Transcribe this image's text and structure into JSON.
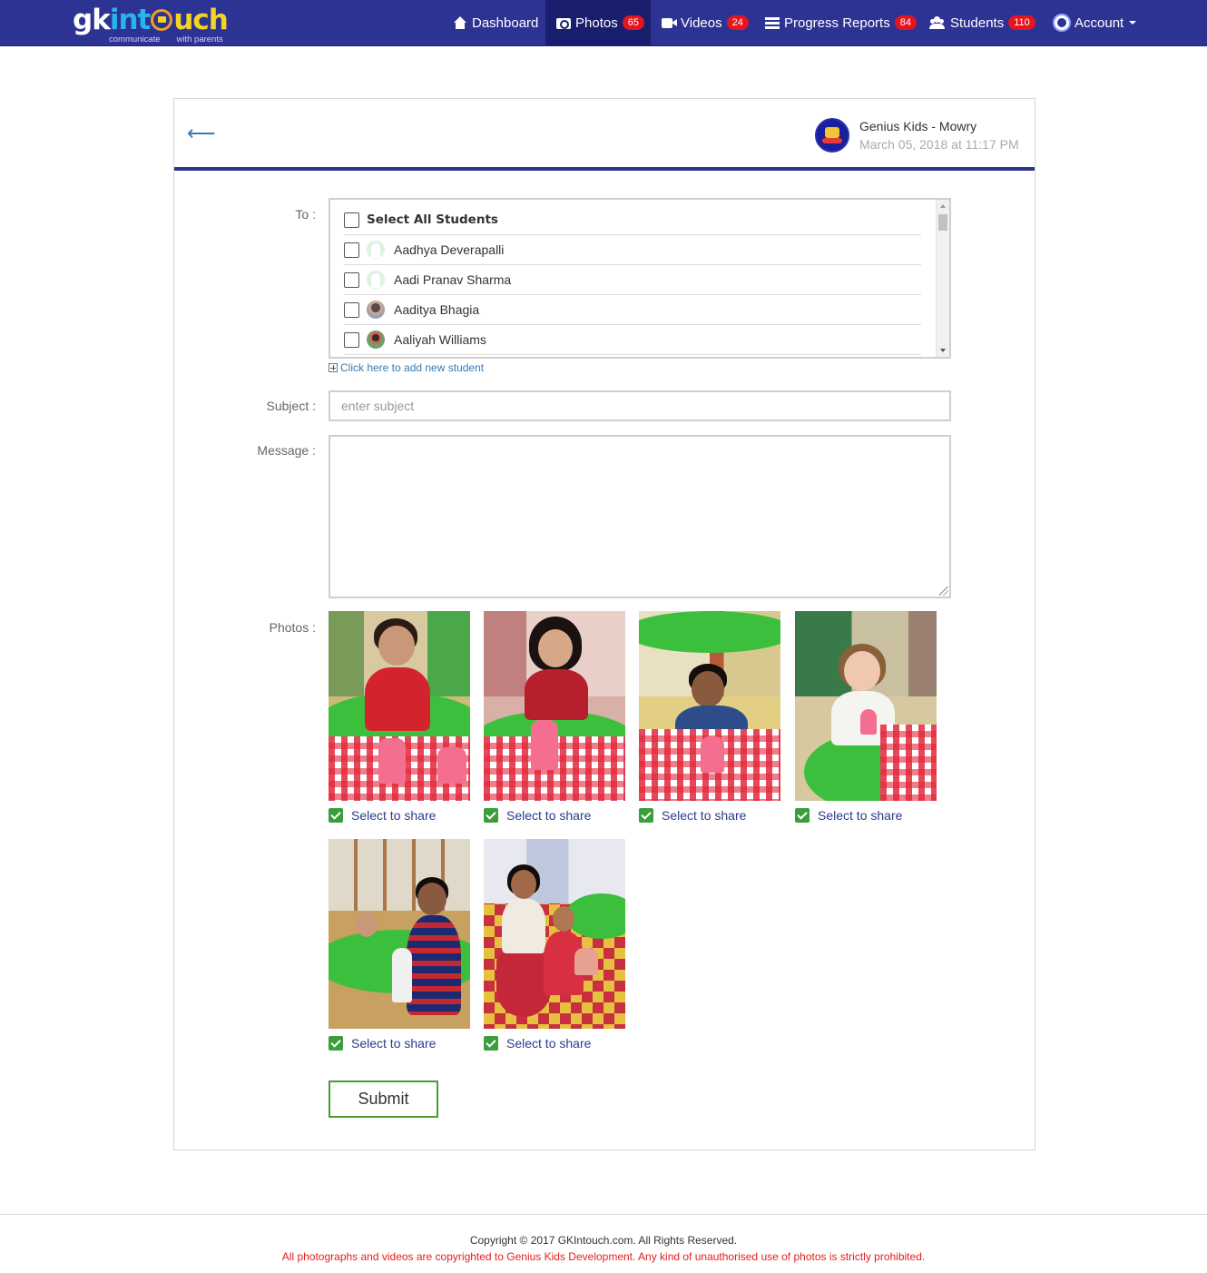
{
  "logo": {
    "part1": "gk",
    "part2": "int",
    "part3": "uch",
    "tagline_left": "communicate",
    "tagline_right": "with parents"
  },
  "nav": {
    "dashboard": {
      "label": "Dashboard"
    },
    "photos": {
      "label": "Photos",
      "count": "65"
    },
    "videos": {
      "label": "Videos",
      "count": "24"
    },
    "progress": {
      "label": "Progress Reports",
      "count": "84"
    },
    "students": {
      "label": "Students",
      "count": "110"
    },
    "account": {
      "label": "Account"
    }
  },
  "header": {
    "back_arrow": "⟵",
    "poster_name": "Genius Kids - Mowry",
    "poster_date": "March 05, 2018 at 11:17 PM"
  },
  "form": {
    "to_label": "To :",
    "select_all": "Select All Students",
    "students": [
      "Aadhya Deverapalli",
      "Aadi Pranav Sharma",
      "Aaditya Bhagia",
      "Aaliyah Williams"
    ],
    "add_student": "Click here to add new student",
    "subject_label": "Subject :",
    "subject_placeholder": "enter subject",
    "subject_value": "",
    "message_label": "Message :",
    "message_value": "",
    "photos_label": "Photos :",
    "share_label": "Select to share",
    "submit": "Submit"
  },
  "colors": {
    "nav_bg": "#2d3393",
    "accent_blue": "#337ab7",
    "badge_red": "#e6141f",
    "check_green": "#3c9d3c",
    "submit_border": "#4a9d2f"
  },
  "footer": {
    "copyright": "Copyright © 2017 GKIntouch.com. All Rights Reserved.",
    "warning": "All photographs and videos are copyrighted to Genius Kids Development. Any kind of unauthorised use of photos is strictly prohibited."
  }
}
